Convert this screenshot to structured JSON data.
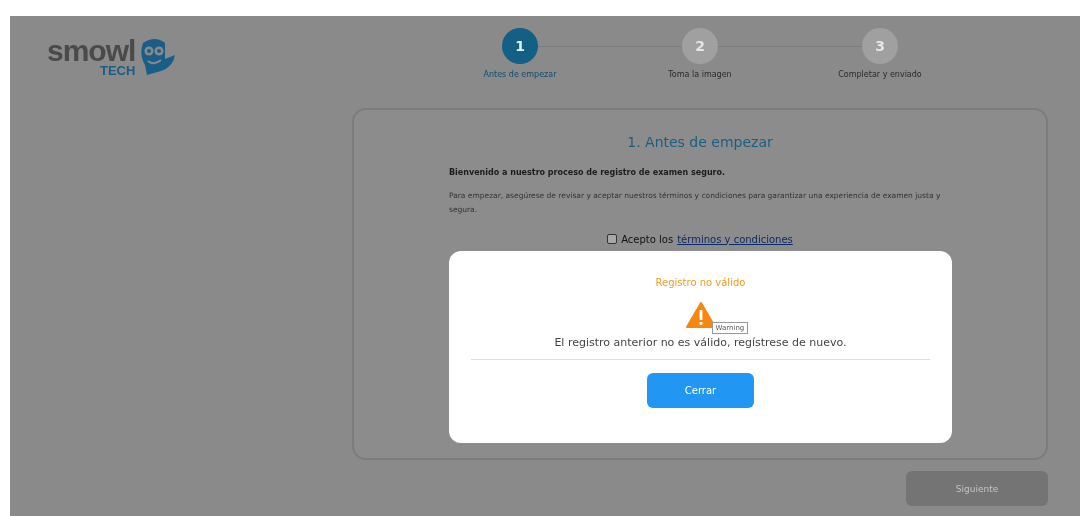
{
  "logo": {
    "wordmark": "smowl",
    "sub": "TECH"
  },
  "steps": [
    {
      "number": "1",
      "label": "Antes de empezar",
      "selected": true
    },
    {
      "number": "2",
      "label": "Toma la imagen",
      "selected": false
    },
    {
      "number": "3",
      "label": "Completar y enviado",
      "selected": false
    }
  ],
  "card": {
    "title": "1. Antes de empezar",
    "intro": "Bienvenido a nuestro proceso de registro de examen seguro.",
    "body": "Para empezar, asegúrese de revisar y aceptar nuestros términos y condiciones para garantizar una experiencia de examen justa y segura.",
    "consent": {
      "text": "Acepto los",
      "link": "términos y condiciones",
      "checked": false
    }
  },
  "next_button": {
    "label": "Siguiente",
    "disabled": true
  },
  "dialog": {
    "title": "Registro no válido",
    "tooltip": "Warning",
    "message": "El registro anterior no es válido, regístrese de nuevo.",
    "button": "Cerrar"
  }
}
